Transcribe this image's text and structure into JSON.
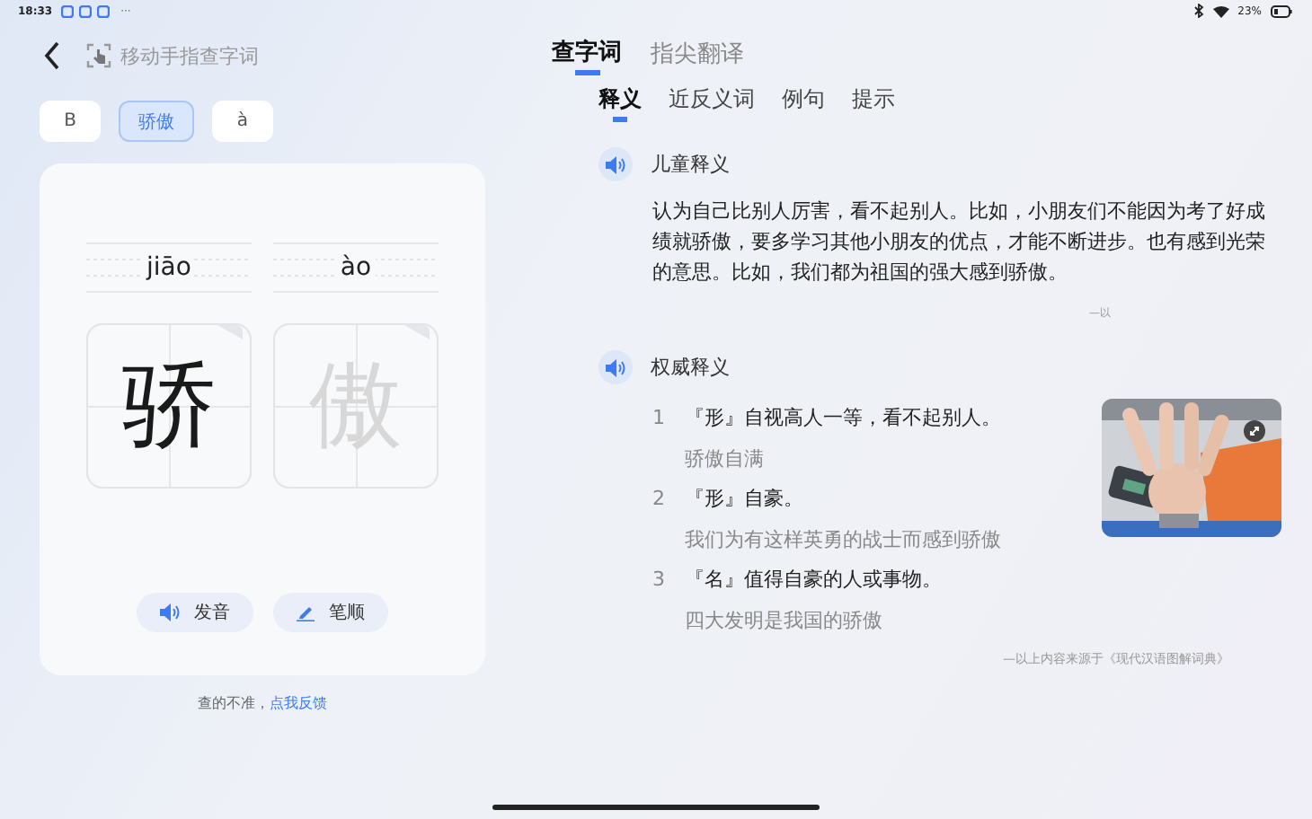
{
  "status_bar": {
    "time": "18:33",
    "more": "···",
    "battery": "23%"
  },
  "header": {
    "hint": "移动手指查字词"
  },
  "tabs": [
    {
      "label": "查字词",
      "selected": true
    },
    {
      "label": "指尖翻译",
      "selected": false
    }
  ],
  "chips": [
    {
      "label": "B",
      "selected": false
    },
    {
      "label": "骄傲",
      "selected": true
    },
    {
      "label": "à",
      "selected": false
    }
  ],
  "characters": [
    {
      "pinyin": "jiāo",
      "char": "骄",
      "written": true
    },
    {
      "pinyin": "ào",
      "char": "傲",
      "written": false
    }
  ],
  "card_buttons": [
    {
      "kind": "sound",
      "label": "发音"
    },
    {
      "kind": "stroke",
      "label": "笔顺"
    }
  ],
  "feedback": {
    "text": "查的不准，",
    "link": "点我反馈"
  },
  "detail_tabs": [
    {
      "label": "释义",
      "selected": true
    },
    {
      "label": "近反义词",
      "selected": false
    },
    {
      "label": "例句",
      "selected": false
    },
    {
      "label": "提示",
      "selected": false
    }
  ],
  "child_section": {
    "title": "儿童释义",
    "text": "认为自己比别人厉害，看不起别人。比如，小朋友们不能因为考了好成绩就骄傲，要多学习其他小朋友的优点，才能不断进步。也有感到光荣的意思。比如，我们都为祖国的强大感到骄傲。",
    "source": "—以"
  },
  "authority_section": {
    "title": "权威释义",
    "entries": [
      {
        "number": "1",
        "definition": "『形』自视高人一等，看不起别人。",
        "example": "骄傲自满"
      },
      {
        "number": "2",
        "definition": "『形』自豪。",
        "example": "我们为有这样英勇的战士而感到骄傲"
      },
      {
        "number": "3",
        "definition": "『名』值得自豪的人或事物。",
        "example": "四大发明是我国的骄傲"
      }
    ],
    "source": "—以上内容来源于《现代汉语图解词典》"
  }
}
